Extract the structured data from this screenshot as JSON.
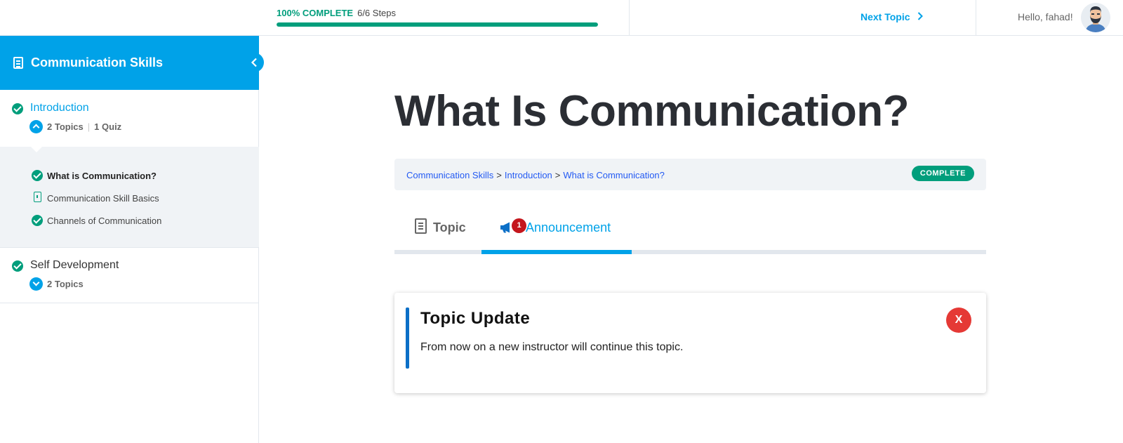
{
  "header": {
    "progress_percent_label": "100% COMPLETE",
    "steps_label": "6/6 Steps",
    "progress_fraction": 1.0,
    "next_topic_label": "Next Topic",
    "greeting": "Hello, fahad!"
  },
  "sidebar": {
    "course_title": "Communication Skills",
    "lessons": [
      {
        "title": "Introduction",
        "meta_topics": "2 Topics",
        "meta_quiz": "1 Quiz",
        "topics": [
          {
            "title": "What is Communication?",
            "icon": "check-icon"
          },
          {
            "title": "Communication Skill Basics",
            "icon": "document-icon"
          },
          {
            "title": "Channels of Communication",
            "icon": "check-icon"
          }
        ]
      },
      {
        "title": "Self Development",
        "meta_topics": "2 Topics"
      }
    ]
  },
  "main": {
    "page_title": "What Is Communication?",
    "breadcrumbs": [
      "Communication Skills",
      "Introduction",
      "What is Communication?"
    ],
    "breadcrumb_separator": ">",
    "status_badge": "COMPLETE",
    "tabs": [
      {
        "label": "Topic"
      },
      {
        "label": "Announcement",
        "badge_count": "1"
      }
    ],
    "announcement": {
      "title": "Topic Update",
      "body": "From now on a new instructor will continue this topic.",
      "close_label": "X"
    }
  },
  "colors": {
    "accent": "#00a2e8",
    "complete": "#019e7c",
    "breadcrumb_link": "#235af3",
    "badge_red": "#c4161c",
    "close_red": "#e53935"
  }
}
